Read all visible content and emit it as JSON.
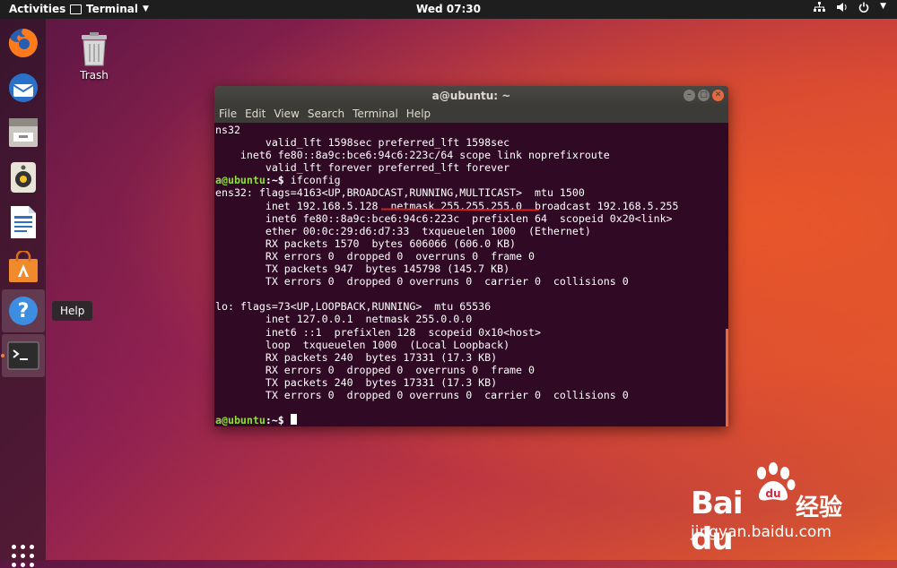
{
  "topbar": {
    "activities": "Activities",
    "app_menu": "Terminal",
    "clock": "Wed 07:30"
  },
  "dock": {
    "items": [
      {
        "name": "firefox"
      },
      {
        "name": "thunderbird"
      },
      {
        "name": "files"
      },
      {
        "name": "rhythmbox"
      },
      {
        "name": "writer"
      },
      {
        "name": "software"
      },
      {
        "name": "help"
      },
      {
        "name": "terminal"
      }
    ],
    "tooltip": "Help"
  },
  "desktop": {
    "trash_label": "Trash"
  },
  "window": {
    "title": "a@ubuntu: ~",
    "menu": [
      "File",
      "Edit",
      "View",
      "Search",
      "Terminal",
      "Help"
    ]
  },
  "terminal": {
    "lines": [
      "ns32",
      "        valid_lft 1598sec preferred_lft 1598sec",
      "    inet6 fe80::8a9c:bce6:94c6:223c/64 scope link noprefixroute",
      "        valid_lft forever preferred_lft forever"
    ],
    "prompt_user": "a@ubuntu",
    "prompt_path": ":~$",
    "command": " ifconfig",
    "output": [
      "ens32: flags=4163<UP,BROADCAST,RUNNING,MULTICAST>  mtu 1500",
      "        inet 192.168.5.128  netmask 255.255.255.0  broadcast 192.168.5.255",
      "        inet6 fe80::8a9c:bce6:94c6:223c  prefixlen 64  scopeid 0x20<link>",
      "        ether 00:0c:29:d6:d7:33  txqueuelen 1000  (Ethernet)",
      "        RX packets 1570  bytes 606066 (606.0 KB)",
      "        RX errors 0  dropped 0  overruns 0  frame 0",
      "        TX packets 947  bytes 145798 (145.7 KB)",
      "        TX errors 0  dropped 0 overruns 0  carrier 0  collisions 0",
      "",
      "lo: flags=73<UP,LOOPBACK,RUNNING>  mtu 65536",
      "        inet 127.0.0.1  netmask 255.0.0.0",
      "        inet6 ::1  prefixlen 128  scopeid 0x10<host>",
      "        loop  txqueuelen 1000  (Local Loopback)",
      "        RX packets 240  bytes 17331 (17.3 KB)",
      "        RX errors 0  dropped 0  overruns 0  frame 0",
      "        TX packets 240  bytes 17331 (17.3 KB)",
      "        TX errors 0  dropped 0 overruns 0  carrier 0  collisions 0",
      ""
    ],
    "final_prompt_user": "a@ubuntu",
    "final_prompt_path": ":~$ "
  },
  "watermark": {
    "logo": "Bai du",
    "cn": "经验",
    "url": "jingyan.baidu.com"
  },
  "colors": {
    "terminal_bg": "#300a24",
    "prompt_green": "#8ae234",
    "accent_orange": "#e8683d"
  }
}
